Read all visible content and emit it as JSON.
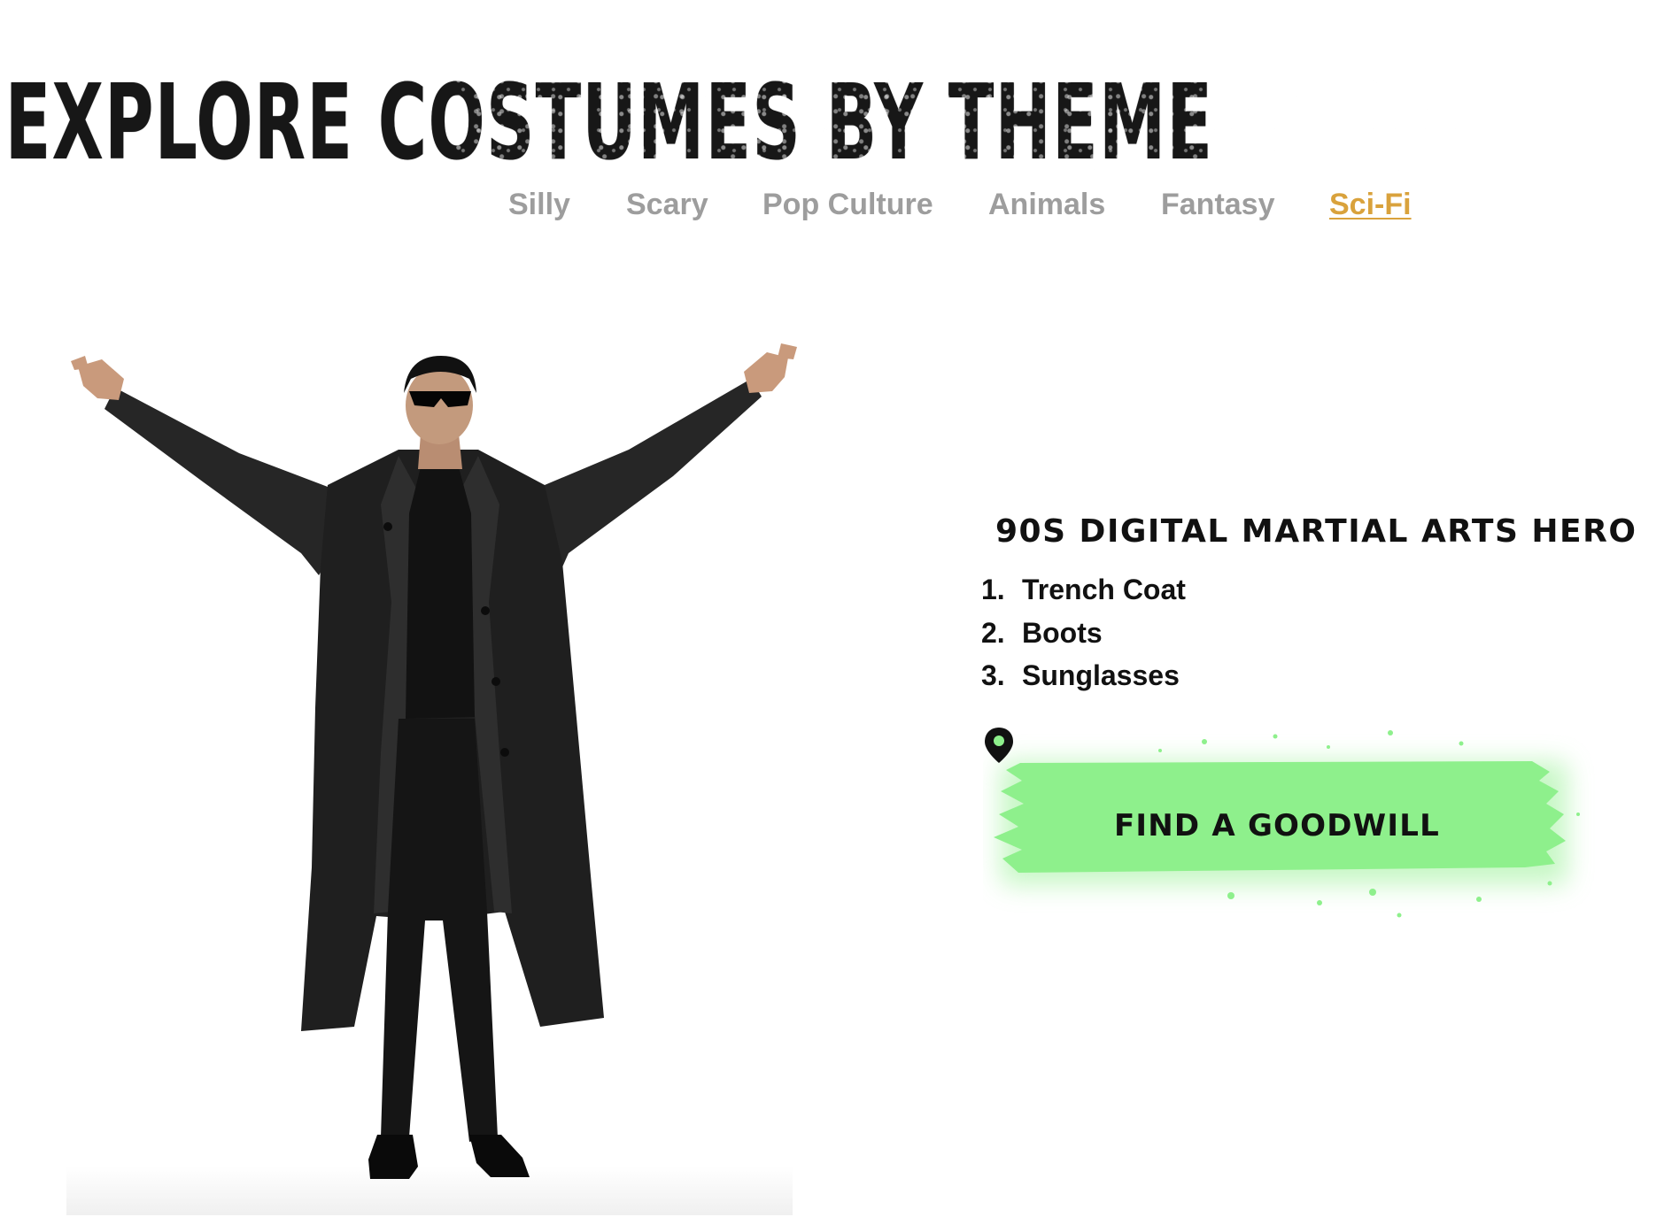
{
  "header": {
    "title": "EXPLORE COSTUMES BY THEME"
  },
  "theme_nav": {
    "items": [
      {
        "label": "Silly",
        "active": false
      },
      {
        "label": "Scary",
        "active": false
      },
      {
        "label": "Pop Culture",
        "active": false
      },
      {
        "label": "Animals",
        "active": false
      },
      {
        "label": "Fantasy",
        "active": false
      },
      {
        "label": "Sci-Fi",
        "active": true
      }
    ]
  },
  "costume": {
    "name": "90S DIGITAL MARTIAL ARTS HERO",
    "items": [
      {
        "number": "1.",
        "label": "Trench Coat"
      },
      {
        "number": "2.",
        "label": "Boots"
      },
      {
        "number": "3.",
        "label": "Sunglasses"
      }
    ]
  },
  "cta": {
    "label": "FIND A GOODWILL",
    "icon": "map-pin-icon"
  },
  "colors": {
    "nav_inactive": "#9d9d9d",
    "nav_active": "#d9a23c",
    "cta_green": "#8ef08c",
    "text_dark": "#111111"
  }
}
